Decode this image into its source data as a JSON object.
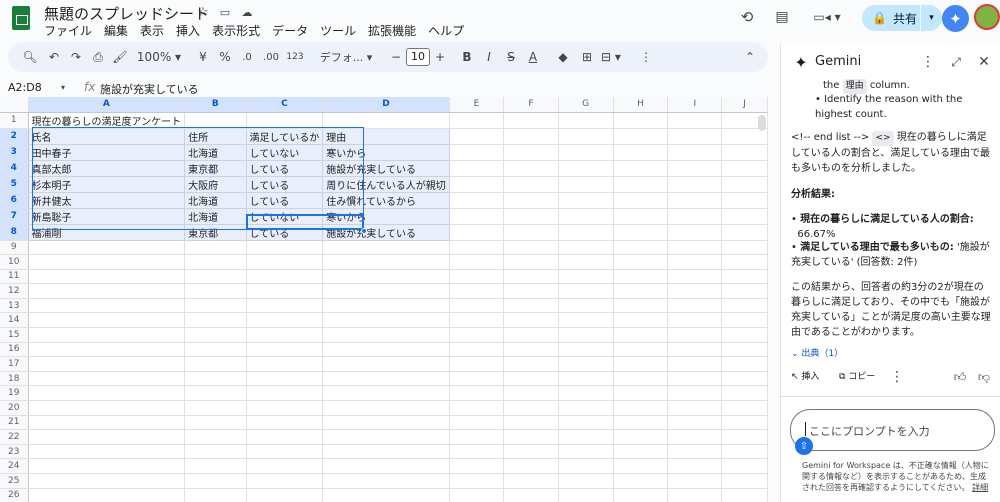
{
  "doc": {
    "title": "無題のスプレッドシート",
    "menu": [
      "ファイル",
      "編集",
      "表示",
      "挿入",
      "表示形式",
      "データ",
      "ツール",
      "拡張機能",
      "ヘルプ"
    ],
    "share_label": "共有"
  },
  "toolbar": {
    "zoom": "100%",
    "currency": "¥",
    "percent": "%",
    "dec_decrease": ".0",
    "dec_increase": ".00",
    "number_format": "123",
    "font": "デフォ...",
    "font_size": "10"
  },
  "formula_bar": {
    "name_box": "A2:D8",
    "fx": "fx",
    "value": "施設が充実している"
  },
  "sheet": {
    "columns": [
      "A",
      "B",
      "C",
      "D",
      "E",
      "F",
      "G",
      "H",
      "I",
      "J"
    ],
    "rows": [
      [
        "1",
        "現在の暮らしの満足度アンケート",
        "",
        "",
        ""
      ],
      [
        "2",
        "氏名",
        "住所",
        "満足しているか",
        "理由"
      ],
      [
        "3",
        "田中春子",
        "北海道",
        "していない",
        "寒いから"
      ],
      [
        "4",
        "真部太郎",
        "東京都",
        "している",
        "施設が充実している"
      ],
      [
        "5",
        "杉本明子",
        "大阪府",
        "している",
        "周りに住んでいる人が親切"
      ],
      [
        "6",
        "新井健太",
        "北海道",
        "している",
        "住み慣れているから"
      ],
      [
        "7",
        "新島聡子",
        "北海道",
        "していない",
        "寒いから"
      ],
      [
        "8",
        "福浦剛",
        "東京都",
        "している",
        "施設が充実している"
      ],
      [
        "9",
        "",
        "",
        "",
        ""
      ],
      [
        "10",
        "",
        "",
        "",
        ""
      ],
      [
        "11",
        "",
        "",
        "",
        ""
      ],
      [
        "12",
        "",
        "",
        "",
        ""
      ],
      [
        "13",
        "",
        "",
        "",
        ""
      ],
      [
        "14",
        "",
        "",
        "",
        ""
      ],
      [
        "15",
        "",
        "",
        "",
        ""
      ],
      [
        "16",
        "",
        "",
        "",
        ""
      ],
      [
        "17",
        "",
        "",
        "",
        ""
      ],
      [
        "18",
        "",
        "",
        "",
        ""
      ],
      [
        "19",
        "",
        "",
        "",
        ""
      ],
      [
        "20",
        "",
        "",
        "",
        ""
      ],
      [
        "21",
        "",
        "",
        "",
        ""
      ],
      [
        "22",
        "",
        "",
        "",
        ""
      ],
      [
        "23",
        "",
        "",
        "",
        ""
      ],
      [
        "24",
        "",
        "",
        "",
        ""
      ],
      [
        "25",
        "",
        "",
        "",
        ""
      ],
      [
        "26",
        "",
        "",
        "",
        ""
      ]
    ]
  },
  "gemini": {
    "title": "Gemini",
    "top_line1": "the",
    "top_chip": "理由",
    "top_line1b": "column.",
    "bullet_prev": "Identify the reason with the highest count.",
    "list_marker": "<!-- end list -->",
    "code_chip": "<>",
    "intro": "現在の暮らしに満足している人の割合と、満足している理由で最も多いものを分析しました。",
    "result_heading": "分析結果:",
    "b1_label": "現在の暮らしに満足している人の割合:",
    "b1_value": "66.67%",
    "b2_label": "満足している理由で最も多いもの:",
    "b2_value": "'施設が充実している' (回答数: 2件)",
    "conclusion": "この結果から、回答者の約3分の2が現在の暮らしに満足しており、その中でも「施設が充実している」ことが満足度の高い主要な理由であることがわかります。",
    "sources": "出典（1）",
    "insert": "挿入",
    "copy": "コピー",
    "prompt_placeholder": "ここにプロンプトを入力",
    "footer": "Gemini for Workspace は、不正確な情報（人物に関する情報など）を表示することがあるため、生成された回答を再確認するようにしてください。",
    "footer_link": "詳細"
  },
  "colors": {
    "accent": "#1a73e8",
    "share_bg": "#c2e7ff",
    "sheets_green": "#188038"
  }
}
